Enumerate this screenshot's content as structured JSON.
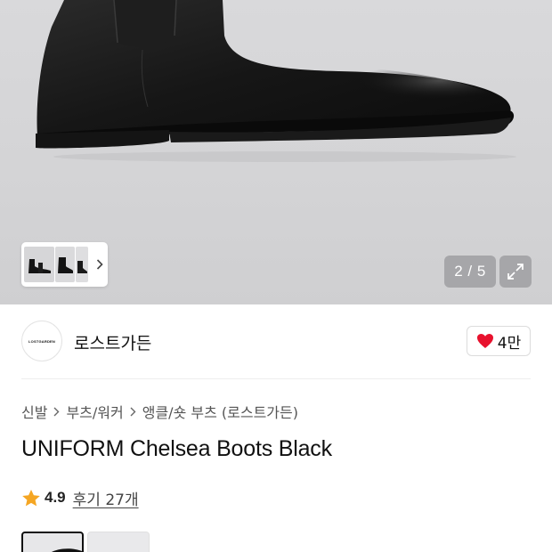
{
  "gallery": {
    "counter": "2 / 5",
    "icons": {
      "next": "chevron-right-icon",
      "expand": "expand-icon"
    }
  },
  "brand": {
    "logo_text": "LOSTGARDEN",
    "name": "로스트가든",
    "likes": "4만",
    "heart_color": "#e8112d"
  },
  "breadcrumb": [
    "신발",
    "부츠/워커",
    "앵클/숏 부츠 (로스트가든)"
  ],
  "product": {
    "title": "UNIFORM Chelsea Boots Black",
    "rating": "4.9",
    "reviews": "후기 27개",
    "star_color": "#f5a623"
  }
}
